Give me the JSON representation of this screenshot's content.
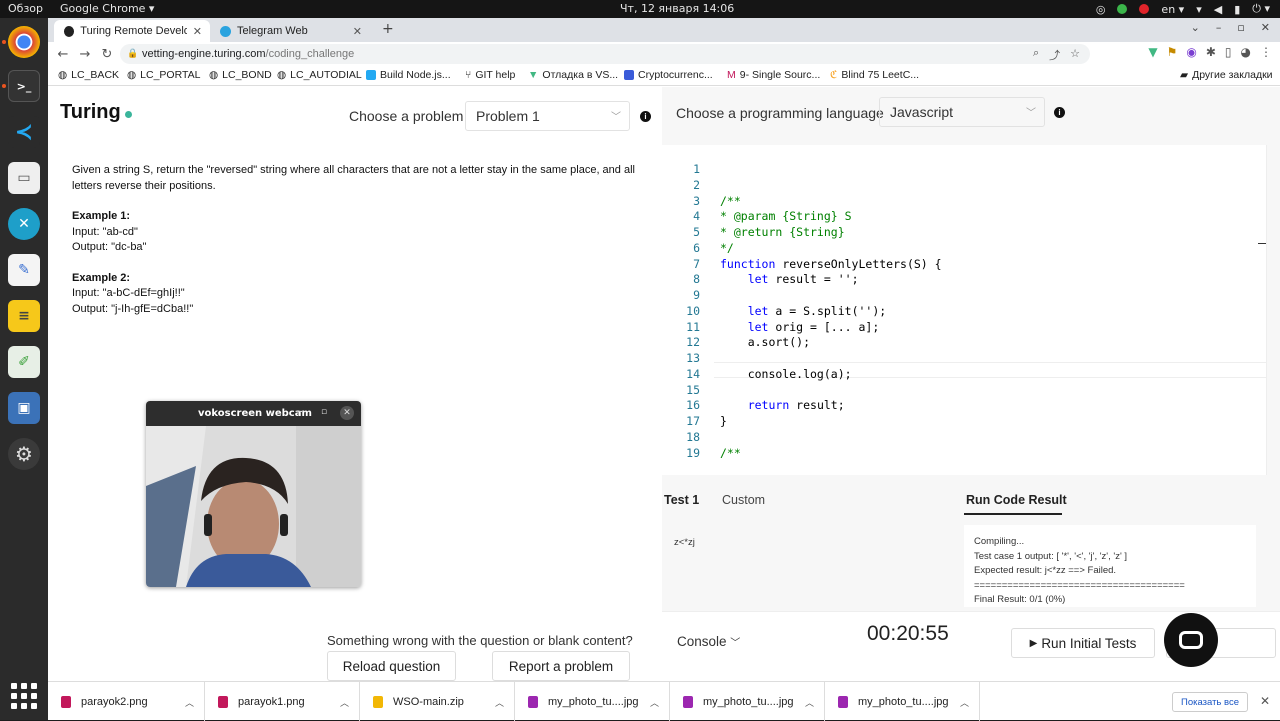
{
  "system_bar": {
    "overview": "Обзор",
    "app_menu": "Google Chrome",
    "clock": "Чт, 12 января  14:06",
    "lang": "en"
  },
  "dock": {
    "items": [
      "chrome",
      "terminal",
      "vscode",
      "files",
      "remote-desktop",
      "text-editor",
      "notes",
      "draw",
      "screenshot",
      "settings"
    ]
  },
  "browser": {
    "tabs": [
      {
        "label": "Turing Remote Developer"
      },
      {
        "label": "Telegram Web"
      }
    ],
    "url_host": "vetting-engine.turing.com",
    "url_path": "/coding_challenge",
    "bookmarks": [
      "LC_BACK",
      "LC_PORTAL",
      "LC_BOND",
      "LC_AUTODIAL",
      "Build Node.js...",
      "GIT help",
      "Отладка в VS...",
      "Cryptocurrenc...",
      "9- Single Sourc...",
      "Blind 75 LeetC..."
    ],
    "other_bookmarks": "Другие закладки"
  },
  "header": {
    "logo": "Turing",
    "choose_problem_label": "Choose a problem",
    "problem_select": "Problem 1",
    "choose_language_label": "Choose a programming language",
    "language_select": "Javascript"
  },
  "problem": {
    "statement": "Given a string S, return the \"reversed\" string where all characters that are not a letter stay in the same place, and all letters reverse their positions.",
    "example1_title": "Example 1:",
    "example1_input": "Input: \"ab-cd\"",
    "example1_output": "Output: \"dc-ba\"",
    "example2_title": "Example 2:",
    "example2_input": "Input: \"a-bC-dEf=ghIj!!\"",
    "example2_output": "Output: \"j-Ih-gfE=dCba!!\""
  },
  "feedback": {
    "question": "Something wrong with the question or blank content?",
    "reload_label": "Reload question",
    "report_label": "Report a problem"
  },
  "editor": {
    "line_numbers": [
      "1",
      "2",
      "3",
      "4",
      "5",
      "6",
      "7",
      "8",
      "9",
      "10",
      "11",
      "12",
      "13",
      "14",
      "15",
      "16",
      "17",
      "18",
      "19"
    ],
    "lines": [
      "",
      "",
      "/**",
      "* @param {String} S",
      "* @return {String}",
      "*/",
      "function reverseOnlyLetters(S) {",
      "    let result = '';",
      "",
      "    let a = S.split('');",
      "    let orig = [... a];",
      "    a.sort();",
      "",
      "    console.log(a);",
      "",
      "    return result;",
      "}",
      "",
      "/**"
    ]
  },
  "test_tabs": {
    "test1": "Test 1",
    "custom": "Custom",
    "run_result": "Run Code Result"
  },
  "test_input": "z<*zj",
  "run_result": {
    "line1": "Compiling...",
    "line2": "Test case 1 output: [ '*', '<', 'j', 'z', 'z' ]",
    "line3": "Expected result: j<*zz ==> Failed.",
    "line4": "======================================",
    "line5": "Final Result: 0/1 (0%)"
  },
  "bottom": {
    "console_label": "Console",
    "timer": "00:20:55",
    "run_tests_label": "Run Initial Tests",
    "submit_label": "Su"
  },
  "webcam": {
    "title": "vokoscreen webcam"
  },
  "downloads": {
    "items": [
      "parayok2.png",
      "parayok1.png",
      "WSO-main.zip",
      "my_photo_tu....jpg",
      "my_photo_tu....jpg",
      "my_photo_tu....jpg"
    ],
    "show_all": "Показать все"
  },
  "colors": {
    "accent_green": "#3bb59b",
    "keyword_blue": "#0000ff",
    "comment_green": "#008000",
    "ubuntu_orange": "#e95420"
  }
}
